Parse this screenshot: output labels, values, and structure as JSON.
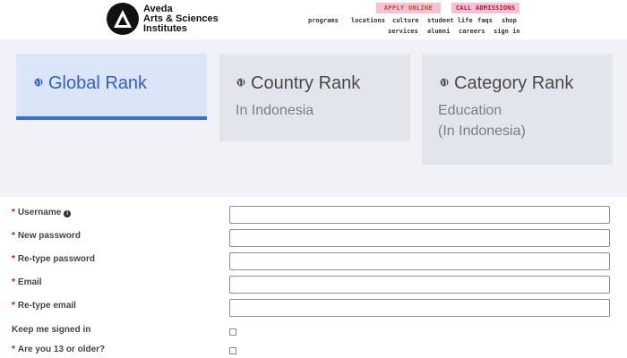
{
  "header": {
    "logo_line1": "Aveda",
    "logo_line2": "Arts & Sciences",
    "logo_line3": "Institutes",
    "apply_label": "APPLY ONLINE",
    "call_label": "CALL ADMISSIONS",
    "nav_row1": [
      "programs",
      "locations",
      "culture",
      "student life",
      "faqs",
      "shop"
    ],
    "nav_row2": [
      "services",
      "alumni",
      "careers",
      "sign in"
    ]
  },
  "rank": {
    "global": {
      "title": "Global Rank"
    },
    "country": {
      "title": "Country Rank",
      "sub": "In Indonesia"
    },
    "category": {
      "title": "Category Rank",
      "sub1": "Education",
      "sub2": "(In Indonesia)"
    }
  },
  "form": {
    "username_label": "Username",
    "new_password_label": "New password",
    "retype_password_label": "Re-type password",
    "email_label": "Email",
    "retype_email_label": "Re-type email",
    "keep_signed_in_label": "Keep me signed in",
    "age_label": "Are you 13 or older?",
    "required_mark": "*",
    "info_glyph": "i"
  },
  "colors": {
    "accent": "#3b6be0",
    "required": "#c0141c",
    "button_bg": "#f4c1d6"
  }
}
